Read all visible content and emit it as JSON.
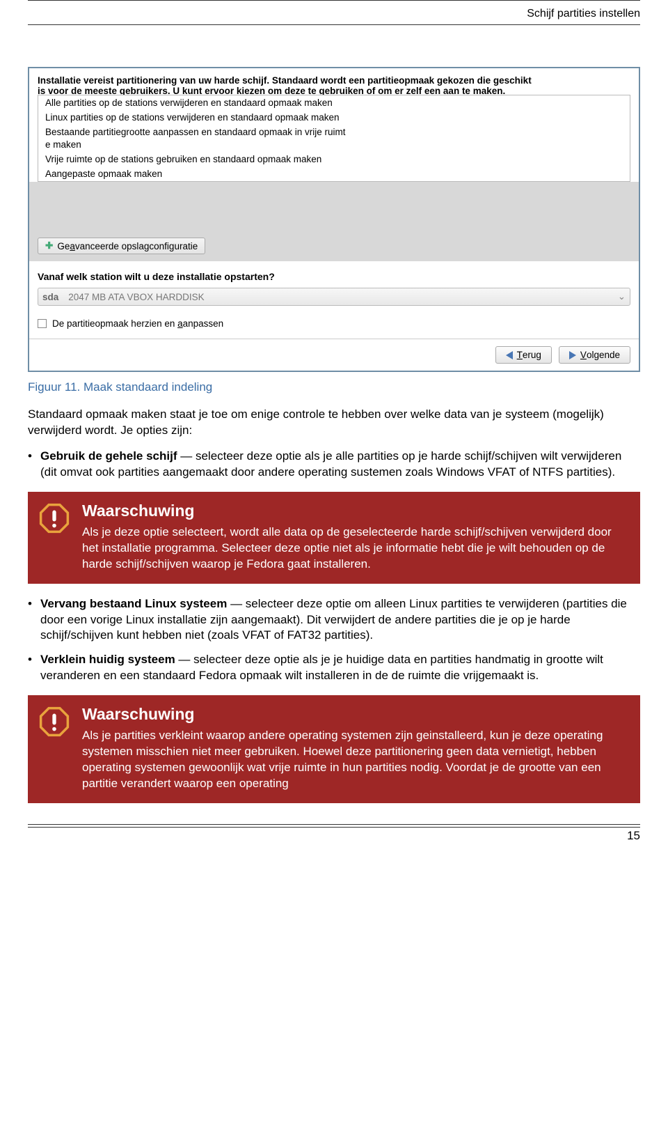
{
  "header": {
    "title": "Schijf partities instellen"
  },
  "screenshot": {
    "intro_line1": "Installatie vereist partitionering van uw harde schijf. Standaard wordt een partitieopmaak gekozen die geschikt",
    "intro_line2": "is voor de meeste gebruikers. U kunt ervoor kiezen om deze te gebruiken of om er zelf een aan te maken.",
    "options": [
      "Alle partities op de stations verwijderen en standaard opmaak maken",
      "Linux partities op de stations verwijderen en standaard opmaak maken",
      "Bestaande partitiegrootte aanpassen en standaard opmaak in vrije ruimt",
      "e maken",
      "Vrije ruimte op de stations gebruiken en standaard opmaak maken",
      "Aangepaste opmaak maken"
    ],
    "advanced_btn_pre": "Ge",
    "advanced_btn_accel": "a",
    "advanced_btn_post": "vanceerde opslagconfiguratie",
    "boot_title": "Vanaf welk station wilt u deze installatie opstarten?",
    "boot_sda": "sda",
    "boot_disk": "2047 MB ATA VBOX HARDDISK",
    "checkbox_pre": "De partitieopmaak herzien en ",
    "checkbox_accel": "a",
    "checkbox_post": "anpassen",
    "back_accel": "T",
    "back_label": "erug",
    "next_accel": "V",
    "next_label": "olgende"
  },
  "figure_caption": "Figuur 11. Maak standaard indeling",
  "intro_para": "Standaard opmaak maken staat je toe om enige controle te hebben over welke data van je systeem (mogelijk) verwijderd wordt. Je opties zijn:",
  "bullet1": {
    "bold": "Gebruik de gehele schijf",
    "rest": " — selecteer deze optie als je alle partities op je harde schijf/schijven wilt verwijderen (dit omvat ook partities aangemaakt door andere operating sustemen zoals Windows VFAT of NTFS partities)."
  },
  "warning1": {
    "title": "Waarschuwing",
    "body": "Als je deze optie selecteert, wordt alle data op de geselecteerde harde schijf/schijven verwijderd door het installatie programma. Selecteer deze optie niet als je informatie hebt die je wilt behouden op de harde schijf/schijven waarop je Fedora gaat installeren."
  },
  "bullet2": {
    "bold": "Vervang bestaand Linux systeem",
    "rest": " — selecteer deze optie om alleen Linux partities te verwijderen (partities die door een vorige Linux installatie zijn aangemaakt). Dit verwijdert de andere partities die je op je harde schijf/schijven kunt hebben niet (zoals VFAT of FAT32 partities)."
  },
  "bullet3": {
    "bold": "Verklein huidig systeem",
    "rest": " — selecteer deze optie als je je huidige data en partities handmatig in grootte wilt veranderen en een standaard Fedora opmaak wilt installeren in de de ruimte die vrijgemaakt is."
  },
  "warning2": {
    "title": "Waarschuwing",
    "body": "Als je partities verkleint waarop andere operating systemen zijn geinstalleerd, kun je deze operating systemen misschien niet meer gebruiken. Hoewel deze partitionering geen data vernietigt, hebben operating systemen gewoonlijk wat vrije ruimte in hun partities nodig. Voordat je de grootte van een partitie verandert waarop een operating"
  },
  "page_number": "15"
}
